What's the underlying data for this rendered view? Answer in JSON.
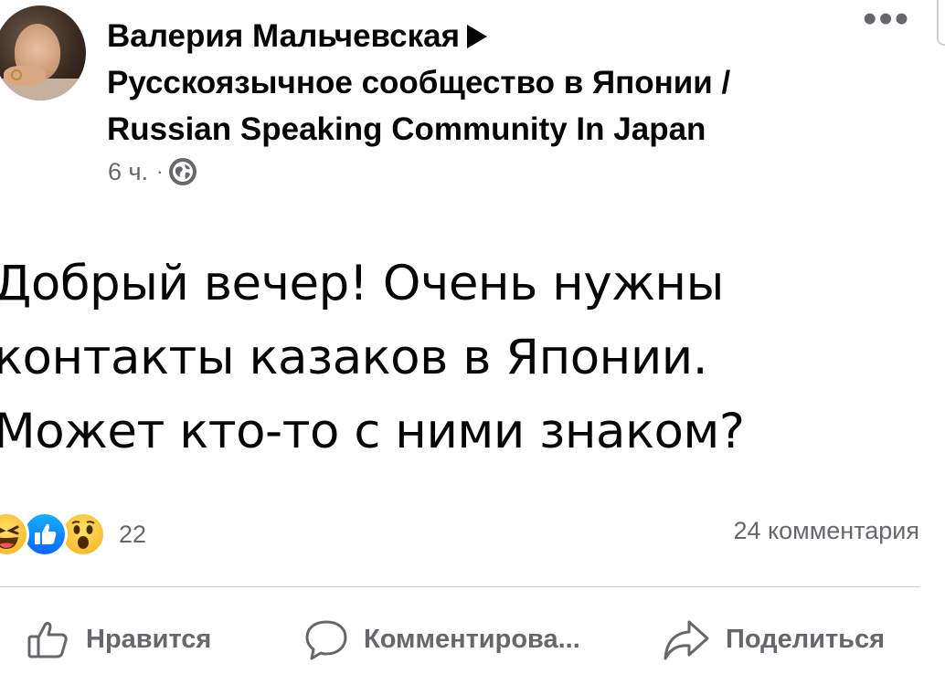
{
  "post": {
    "author": "Валерия Мальчевская",
    "group_line1": "Русскоязычное сообщество в Японии /",
    "group_line2": "Russian Speaking Community In Japan",
    "time": "6 ч.",
    "dot": "·",
    "privacy_icon": "globe-icon",
    "more_label": "•••",
    "text_lines": [
      "Добрый вечер! Очень нужны",
      "контакты казаков в Японии.",
      "Может кто-то с ними знаком?"
    ]
  },
  "reactions": {
    "icons": [
      "haha-reaction-icon",
      "like-reaction-icon",
      "wow-reaction-icon"
    ],
    "count": "22",
    "comments": "24 комментария"
  },
  "actions": {
    "like": "Нравится",
    "comment": "Комментирова...",
    "share": "Поделиться"
  },
  "colors": {
    "text": "#050505",
    "secondary": "#65676b",
    "like_blue": "#0866ff",
    "reaction_yellow": "#f7b928"
  }
}
